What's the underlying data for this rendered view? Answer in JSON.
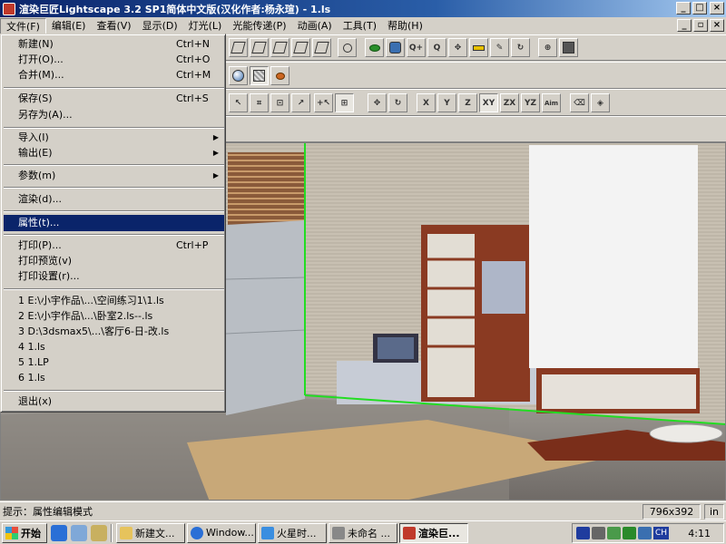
{
  "window": {
    "title": "渲染巨匠Lightscape 3.2 SP1简体中文版(汉化作者:杨永瑄) - 1.ls",
    "min_label": "_",
    "max_label": "□",
    "close_label": "×"
  },
  "mdi": {
    "min_label": "_",
    "restore_label": "▫",
    "close_label": "×"
  },
  "menubar": [
    {
      "label": "文件(F)"
    },
    {
      "label": "编辑(E)"
    },
    {
      "label": "查看(V)"
    },
    {
      "label": "显示(D)"
    },
    {
      "label": "灯光(L)"
    },
    {
      "label": "光能传递(P)"
    },
    {
      "label": "动画(A)"
    },
    {
      "label": "工具(T)"
    },
    {
      "label": "帮助(H)"
    }
  ],
  "toolbar": {
    "axis_labels": [
      "X",
      "Y",
      "Z",
      "XY",
      "ZX",
      "YZ",
      "Aim"
    ]
  },
  "file_menu": {
    "items": [
      {
        "label": "新建(N)",
        "shortcut": "Ctrl+N"
      },
      {
        "label": "打开(O)...",
        "shortcut": "Ctrl+O"
      },
      {
        "label": "合并(M)...",
        "shortcut": "Ctrl+M"
      },
      {
        "label": "保存(S)",
        "shortcut": "Ctrl+S"
      },
      {
        "label": "另存为(A)...",
        "shortcut": ""
      },
      {
        "label": "导入(I)",
        "shortcut": "",
        "submenu": true
      },
      {
        "label": "输出(E)",
        "shortcut": "",
        "submenu": true
      },
      {
        "label": "参数(m)",
        "shortcut": "",
        "submenu": true
      },
      {
        "label": "渲染(d)...",
        "shortcut": ""
      },
      {
        "label": "属性(t)...",
        "shortcut": "",
        "highlighted": true
      },
      {
        "label": "打印(P)...",
        "shortcut": "Ctrl+P"
      },
      {
        "label": "打印预览(v)",
        "shortcut": ""
      },
      {
        "label": "打印设置(r)...",
        "shortcut": ""
      },
      {
        "label": "1 E:\\小宇作品\\...\\空间练习1\\1.ls",
        "shortcut": ""
      },
      {
        "label": "2 E:\\小宇作品\\...\\卧室2.ls--.ls",
        "shortcut": ""
      },
      {
        "label": "3 D:\\3dsmax5\\...\\客厅6-日-改.ls",
        "shortcut": ""
      },
      {
        "label": "4 1.ls",
        "shortcut": ""
      },
      {
        "label": "5 1.LP",
        "shortcut": ""
      },
      {
        "label": "6 1.ls",
        "shortcut": ""
      },
      {
        "label": "退出(x)",
        "shortcut": ""
      }
    ]
  },
  "statusbar": {
    "hint": "提示：属性编辑模式",
    "size": "796x392",
    "unit": "in"
  },
  "taskbar": {
    "start": "开始",
    "tasks": [
      {
        "label": "新建文..."
      },
      {
        "label": "Window..."
      },
      {
        "label": "火星时..."
      },
      {
        "label": "未命名 ..."
      },
      {
        "label": "渲染巨...",
        "active": true
      }
    ],
    "tray": {
      "lang": "CH",
      "clock": "4:11"
    }
  },
  "colors": {
    "title_start": "#0a246a",
    "menu_highlight": "#0a246a",
    "face": "#d4d0c8",
    "selection_edge": "#22dd22"
  },
  "icons": [
    "document-icon",
    "open-folder-icon",
    "save-icon",
    "zoom-icon",
    "rotate-icon",
    "pan-icon",
    "light-icon",
    "select-icon",
    "radiosity-icon"
  ]
}
